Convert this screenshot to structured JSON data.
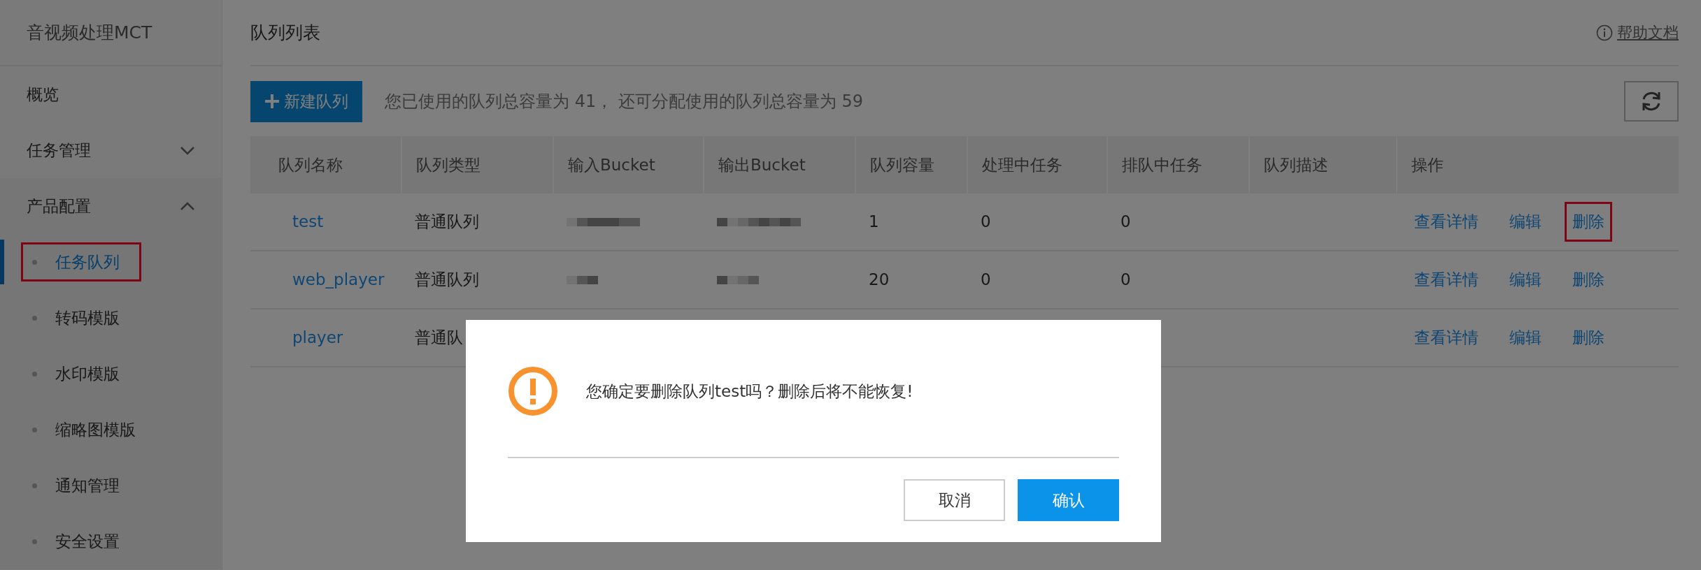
{
  "sidebar": {
    "title": "音视频处理MCT",
    "items": [
      {
        "label": "概览",
        "kind": "link"
      },
      {
        "label": "任务管理",
        "kind": "group",
        "expanded": false
      },
      {
        "label": "产品配置",
        "kind": "group",
        "expanded": true,
        "children": [
          {
            "label": "任务队列",
            "selected": true,
            "annotated": true
          },
          {
            "label": "转码模版",
            "selected": false,
            "annotated": false
          },
          {
            "label": "水印模版",
            "selected": false,
            "annotated": false
          },
          {
            "label": "缩略图模版",
            "selected": false,
            "annotated": false
          },
          {
            "label": "通知管理",
            "selected": false,
            "annotated": false
          },
          {
            "label": "安全设置",
            "selected": false,
            "annotated": false
          }
        ]
      }
    ]
  },
  "page": {
    "title": "队列列表",
    "help": "帮助文档"
  },
  "toolbar": {
    "new_button": "新建队列",
    "quota_text": "您已使用的队列总容量为 41， 还可分配使用的队列总容量为 59"
  },
  "table": {
    "columns": [
      "队列名称",
      "队列类型",
      "输入Bucket",
      "输出Bucket",
      "队列容量",
      "处理中任务",
      "排队中任务",
      "队列描述",
      "操作"
    ],
    "rows": [
      {
        "name": "test",
        "type": "普通队列",
        "input_bucket_redacted": true,
        "output_bucket_redacted": true,
        "capacity": "1",
        "processing": "0",
        "queued": "0",
        "actions": [
          {
            "label": "查看详情",
            "annotated": false
          },
          {
            "label": "编辑",
            "annotated": false
          },
          {
            "label": "删除",
            "annotated": true
          }
        ]
      },
      {
        "name": "web_player",
        "type": "普通队列",
        "input_bucket_redacted": true,
        "output_bucket_redacted": true,
        "capacity": "20",
        "processing": "0",
        "queued": "0",
        "actions": [
          {
            "label": "查看详情",
            "annotated": false
          },
          {
            "label": "编辑",
            "annotated": false
          },
          {
            "label": "删除",
            "annotated": false
          }
        ]
      },
      {
        "name": "player",
        "type": "普通队",
        "actions": [
          {
            "label": "查看详情",
            "annotated": false
          },
          {
            "label": "编辑",
            "annotated": false
          },
          {
            "label": "删除",
            "annotated": false
          }
        ]
      }
    ]
  },
  "dialog": {
    "message": "您确定要删除队列test吗？删除后将不能恢复!",
    "buttons": [
      {
        "label": "取消",
        "kind": "secondary"
      },
      {
        "label": "确认",
        "kind": "primary"
      }
    ]
  }
}
